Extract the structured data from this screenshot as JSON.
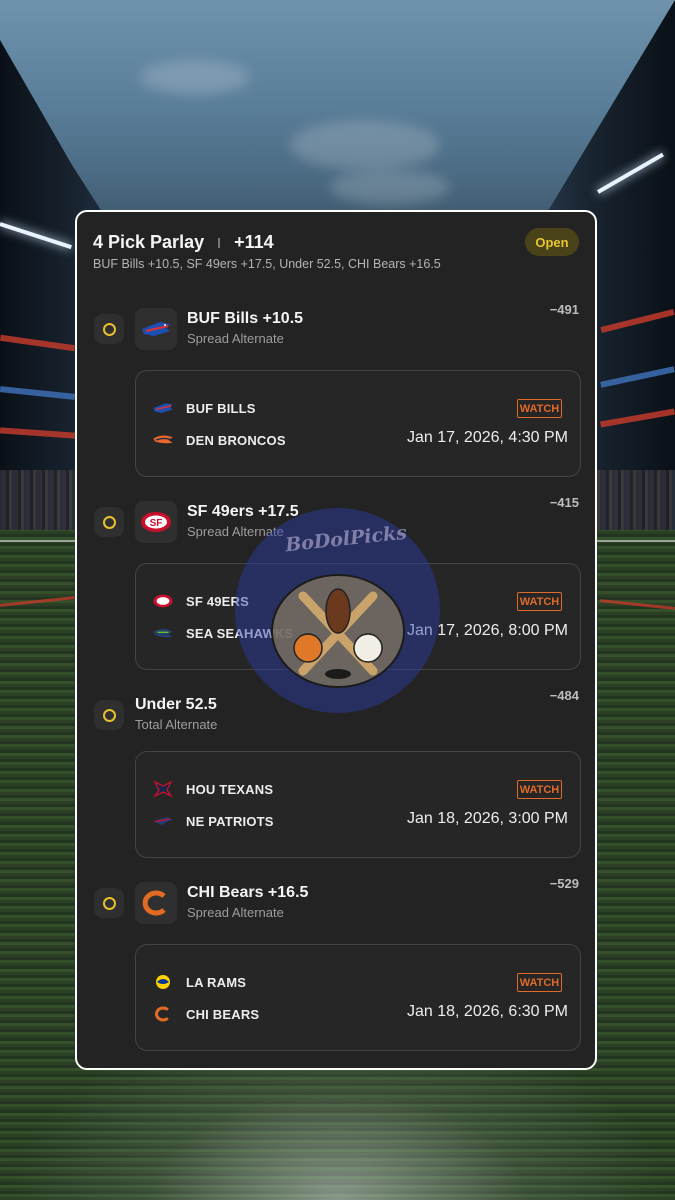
{
  "parlay": {
    "title": "4 Pick Parlay",
    "odds": "+114",
    "summary": "BUF Bills +10.5, SF 49ers +17.5, Under 52.5, CHI Bears +16.5",
    "status": "Open"
  },
  "picks": [
    {
      "title": "BUF Bills +10.5",
      "type": "Spread Alternate",
      "odds": "−491",
      "logo_icon": "bills-logo-icon",
      "game": {
        "team1": "BUF BILLS",
        "team1_icon": "bills-logo-icon",
        "team2": "DEN BRONCOS",
        "team2_icon": "broncos-logo-icon",
        "watch": "WATCH",
        "time": "Jan 17, 2026, 4:30 PM"
      }
    },
    {
      "title": "SF 49ers +17.5",
      "type": "Spread Alternate",
      "odds": "−415",
      "logo_icon": "49ers-logo-icon",
      "game": {
        "team1": "SF 49ERS",
        "team1_icon": "49ers-logo-icon",
        "team2": "SEA SEAHAWKS",
        "team2_icon": "seahawks-logo-icon",
        "watch": "WATCH",
        "time": "Jan 17, 2026, 8:00 PM"
      }
    },
    {
      "title": "Under 52.5",
      "type": "Total Alternate",
      "odds": "−484",
      "logo_icon": "",
      "game": {
        "team1": "HOU TEXANS",
        "team1_icon": "texans-logo-icon",
        "team2": "NE PATRIOTS",
        "team2_icon": "patriots-logo-icon",
        "watch": "WATCH",
        "time": "Jan 18, 2026, 3:00 PM"
      }
    },
    {
      "title": "CHI Bears +16.5",
      "type": "Spread Alternate",
      "odds": "−529",
      "logo_icon": "bears-logo-icon",
      "game": {
        "team1": "LA RAMS",
        "team1_icon": "rams-logo-icon",
        "team2": "CHI BEARS",
        "team2_icon": "bears-logo-icon",
        "watch": "WATCH",
        "time": "Jan 18, 2026, 6:30 PM"
      }
    }
  ],
  "watermark": {
    "text": "BoDolPicks"
  },
  "colors": {
    "card_bg": "#232323",
    "accent_yellow": "#e7c12c",
    "watch_orange": "#e06a2a",
    "open_badge_bg": "#4a4218"
  }
}
